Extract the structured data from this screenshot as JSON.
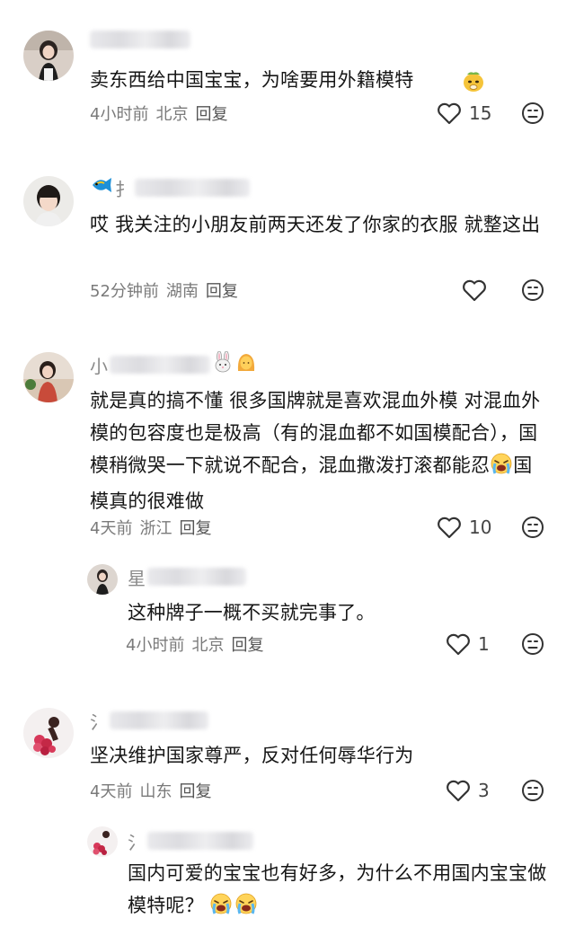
{
  "comments": [
    {
      "name_first": "",
      "text": "卖东西给中国宝宝，为啥要用外籍模特",
      "time": "4小时前",
      "location": "北京",
      "reply_label": "回复",
      "likes": "15"
    },
    {
      "name_first": "",
      "text": "哎 我关注的小朋友前两天还发了你家的衣服 就整这出",
      "time": "52分钟前",
      "location": "湖南",
      "reply_label": "回复",
      "likes": ""
    },
    {
      "name_first": "小",
      "text_part1": "就是真的搞不懂 很多国牌就是喜欢混血外模 对混血外模的包容度也是极高（有的混血都不如国模配合），国模稍微哭一下就说不配合，混血撒泼打滚都能忍",
      "text_part2": "国模真的很难做",
      "time": "4天前",
      "location": "浙江",
      "reply_label": "回复",
      "likes": "10"
    },
    {
      "name_first": "星",
      "text": "这种牌子一概不买就完事了。",
      "time": "4小时前",
      "location": "北京",
      "reply_label": "回复",
      "likes": "1"
    },
    {
      "name_first": "",
      "text": "坚决维护国家尊严，反对任何辱华行为",
      "time": "4天前",
      "location": "山东",
      "reply_label": "回复",
      "likes": "3"
    },
    {
      "name_first": "",
      "text": "国内可爱的宝宝也有好多，为什么不用国内宝宝做模特呢？",
      "time": "",
      "location": "",
      "reply_label": "",
      "likes": ""
    }
  ],
  "icons": {
    "like": "heart-outline-icon",
    "dislike": "dislike-face-icon"
  },
  "colors": {
    "meta": "#7a7a7a",
    "text": "#161616"
  }
}
